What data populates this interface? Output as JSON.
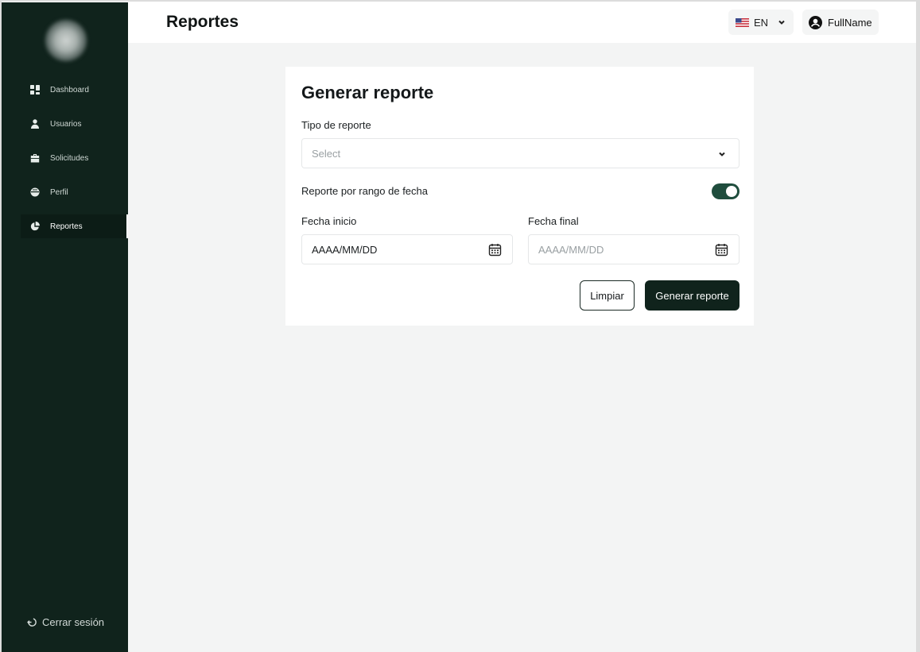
{
  "header": {
    "title": "Reportes",
    "language": "EN",
    "user_name": "FullName"
  },
  "sidebar": {
    "items": [
      {
        "label": "Dashboard",
        "icon": "grid-icon",
        "active": false
      },
      {
        "label": "Usuarios",
        "icon": "user-icon",
        "active": false
      },
      {
        "label": "Solicitudes",
        "icon": "briefcase-icon",
        "active": false
      },
      {
        "label": "Perfil",
        "icon": "globe-icon",
        "active": false
      },
      {
        "label": "Reportes",
        "icon": "pie-chart-icon",
        "active": true
      }
    ],
    "logout_label": "Cerrar sesión"
  },
  "form": {
    "title": "Generar reporte",
    "report_type_label": "Tipo de reporte",
    "report_type_placeholder": "Select",
    "date_range_label": "Reporte por rango de fecha",
    "date_range_enabled": true,
    "start_date_label": "Fecha inicio",
    "start_date_value": "AAAA/MM/DD",
    "end_date_label": "Fecha final",
    "end_date_placeholder": "AAAA/MM/DD",
    "clear_button": "Limpiar",
    "generate_button": "Generar reporte"
  },
  "colors": {
    "sidebar_bg": "#10231c",
    "accent": "#1f4d3d",
    "page_bg": "#f3f4f4"
  }
}
